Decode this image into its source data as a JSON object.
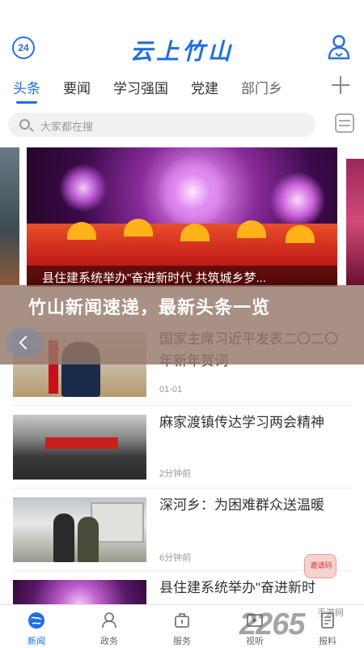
{
  "header": {
    "timer_label": "24",
    "app_title": "云上竹山",
    "timer_icon": "timer-badge-icon",
    "user_icon": "user-profile-icon"
  },
  "tabs": [
    {
      "label": "头条",
      "active": true
    },
    {
      "label": "要闻",
      "active": false
    },
    {
      "label": "学习强国",
      "active": false
    },
    {
      "label": "党建",
      "active": false
    },
    {
      "label": "部门乡",
      "active": false
    }
  ],
  "search": {
    "placeholder": "大家都在搜"
  },
  "banner": {
    "caption": "县住建系统举办\"奋进新时代  共筑城乡梦..."
  },
  "overlay": {
    "title": "竹山新闻速递，最新头条一览"
  },
  "news": [
    {
      "title": "国家主席习近平发表二〇二〇年新年贺词",
      "time": "01-01"
    },
    {
      "title": "麻家渡镇传达学习两会精神",
      "time": "2分钟前"
    },
    {
      "title": "深河乡：为困难群众送温暖",
      "time": "6分钟前"
    },
    {
      "title": "县住建系统举办\"奋进新时",
      "time": ""
    }
  ],
  "float_button": {
    "label": "邀请码"
  },
  "bottom_nav": [
    {
      "label": "新闻",
      "icon": "globe-icon",
      "active": true
    },
    {
      "label": "政务",
      "icon": "government-icon",
      "active": false
    },
    {
      "label": "服务",
      "icon": "service-icon",
      "active": false
    },
    {
      "label": "视听",
      "icon": "video-icon",
      "active": false
    },
    {
      "label": "报料",
      "icon": "report-icon",
      "active": false
    }
  ],
  "watermark": {
    "text": "2265",
    "sub": "手游网"
  },
  "colors": {
    "brand": "#1f6fe5",
    "text": "#333333",
    "muted": "#999999"
  }
}
